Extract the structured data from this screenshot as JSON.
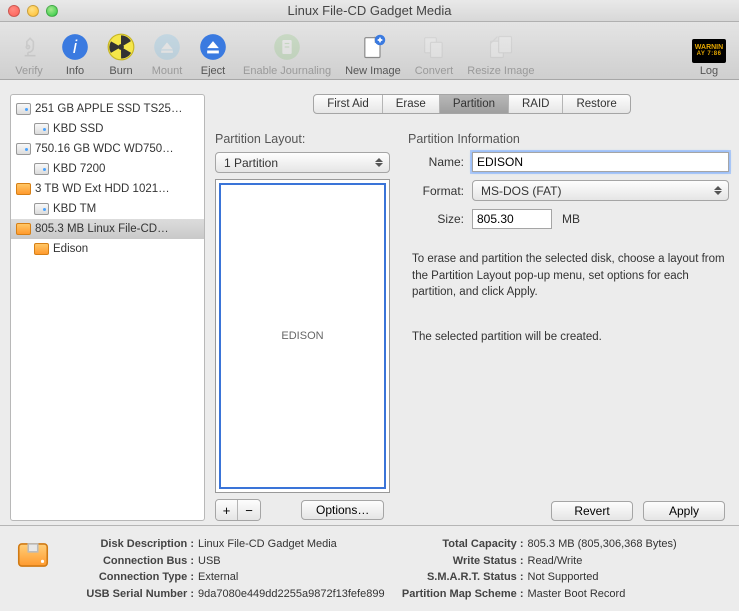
{
  "window": {
    "title": "Linux File-CD Gadget Media"
  },
  "toolbar": {
    "verify": "Verify",
    "info": "Info",
    "burn": "Burn",
    "mount": "Mount",
    "eject": "Eject",
    "journaling": "Enable Journaling",
    "newimage": "New Image",
    "convert": "Convert",
    "resize": "Resize Image",
    "log": "Log",
    "log_badge1": "WARNIN",
    "log_badge2": "AY 7:86"
  },
  "sidebar": [
    {
      "label": "251 GB APPLE SSD TS25…",
      "type": "hdd",
      "level": 0
    },
    {
      "label": "KBD SSD",
      "type": "hdd",
      "level": 1
    },
    {
      "label": "750.16 GB WDC WD750…",
      "type": "hdd",
      "level": 0
    },
    {
      "label": "KBD 7200",
      "type": "hdd",
      "level": 1
    },
    {
      "label": "3 TB WD Ext HDD 1021…",
      "type": "ext",
      "level": 0
    },
    {
      "label": "KBD TM",
      "type": "hdd",
      "level": 1
    },
    {
      "label": "805.3 MB Linux File-CD…",
      "type": "ext",
      "level": 0,
      "selected": true
    },
    {
      "label": "Edison",
      "type": "ext",
      "level": 1
    }
  ],
  "tabs": [
    "First Aid",
    "Erase",
    "Partition",
    "RAID",
    "Restore"
  ],
  "tab_active": 2,
  "layout": {
    "heading": "Partition Layout:",
    "select": "1 Partition",
    "partition_label": "EDISON",
    "options_btn": "Options…"
  },
  "info": {
    "heading": "Partition Information",
    "name_lbl": "Name:",
    "name_val": "EDISON",
    "format_lbl": "Format:",
    "format_val": "MS-DOS (FAT)",
    "size_lbl": "Size:",
    "size_val": "805.30",
    "size_unit": "MB",
    "desc": "To erase and partition the selected disk, choose a layout from the Partition Layout pop-up menu, set options for each partition, and click Apply.",
    "desc2": "The selected partition will be created.",
    "revert": "Revert",
    "apply": "Apply"
  },
  "footer": {
    "left": [
      {
        "k": "Disk Description :",
        "v": "Linux File-CD Gadget Media"
      },
      {
        "k": "Connection Bus :",
        "v": "USB"
      },
      {
        "k": "Connection Type :",
        "v": "External"
      },
      {
        "k": "USB Serial Number :",
        "v": "9da7080e449dd2255a9872f13fefe899"
      }
    ],
    "right": [
      {
        "k": "Total Capacity :",
        "v": "805.3 MB (805,306,368 Bytes)"
      },
      {
        "k": "Write Status :",
        "v": "Read/Write"
      },
      {
        "k": "S.M.A.R.T. Status :",
        "v": "Not Supported"
      },
      {
        "k": "Partition Map Scheme :",
        "v": "Master Boot Record"
      }
    ]
  }
}
